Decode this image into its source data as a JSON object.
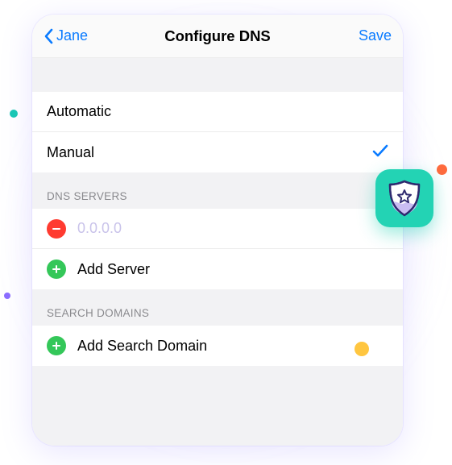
{
  "nav": {
    "back_label": "Jane",
    "title": "Configure DNS",
    "save_label": "Save"
  },
  "mode": {
    "options": [
      "Automatic",
      "Manual"
    ],
    "selected_index": 1
  },
  "dns_servers": {
    "header": "DNS SERVERS",
    "input_value": "",
    "input_placeholder": "0.0.0.0",
    "add_label": "Add Server"
  },
  "search_domains": {
    "header": "SEARCH DOMAINS",
    "add_label": "Add Search Domain"
  },
  "badge": {
    "icon": "shield-star"
  },
  "colors": {
    "accent": "#0a7bff",
    "badge_bg": "#23d3b4"
  }
}
